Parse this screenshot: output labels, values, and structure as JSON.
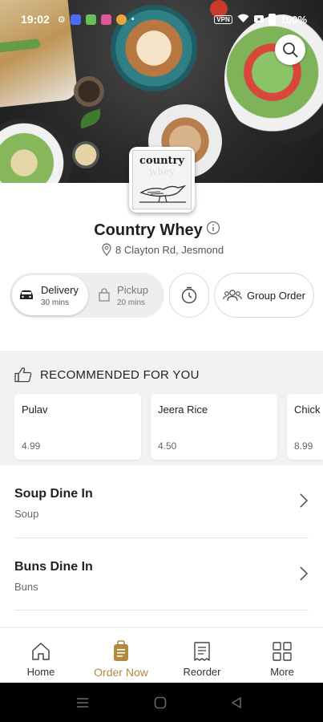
{
  "status_bar": {
    "time": "19:02",
    "battery": "100%",
    "vpn": "VPN"
  },
  "store": {
    "name": "Country Whey",
    "address": "8 Clayton Rd, Jesmond",
    "logo_text_line1": "country",
    "logo_text_line2": "whey"
  },
  "order_modes": {
    "delivery": {
      "label": "Delivery",
      "time": "30 mins",
      "selected": true
    },
    "pickup": {
      "label": "Pickup",
      "time": "20 mins",
      "selected": false
    }
  },
  "group_order_label": "Group Order",
  "recommended": {
    "title": "RECOMMENDED FOR YOU",
    "items": [
      {
        "name": "Pulav",
        "price": "4.99"
      },
      {
        "name": "Jeera Rice",
        "price": "4.50"
      },
      {
        "name": "Chick",
        "price": "8.99"
      }
    ]
  },
  "categories": [
    {
      "title": "Soup Dine In",
      "subtitle": "Soup"
    },
    {
      "title": "Buns Dine In",
      "subtitle": "Buns"
    }
  ],
  "bottom_nav": [
    {
      "label": "Home",
      "icon": "home-icon",
      "active": false
    },
    {
      "label": "Order Now",
      "icon": "order-bag-icon",
      "active": true
    },
    {
      "label": "Reorder",
      "icon": "receipt-icon",
      "active": false
    },
    {
      "label": "More",
      "icon": "grid-icon",
      "active": false
    }
  ],
  "colors": {
    "accent": "#b08a3e",
    "section_bg": "#f2f2f2",
    "pill_bg": "#eeeeee"
  }
}
